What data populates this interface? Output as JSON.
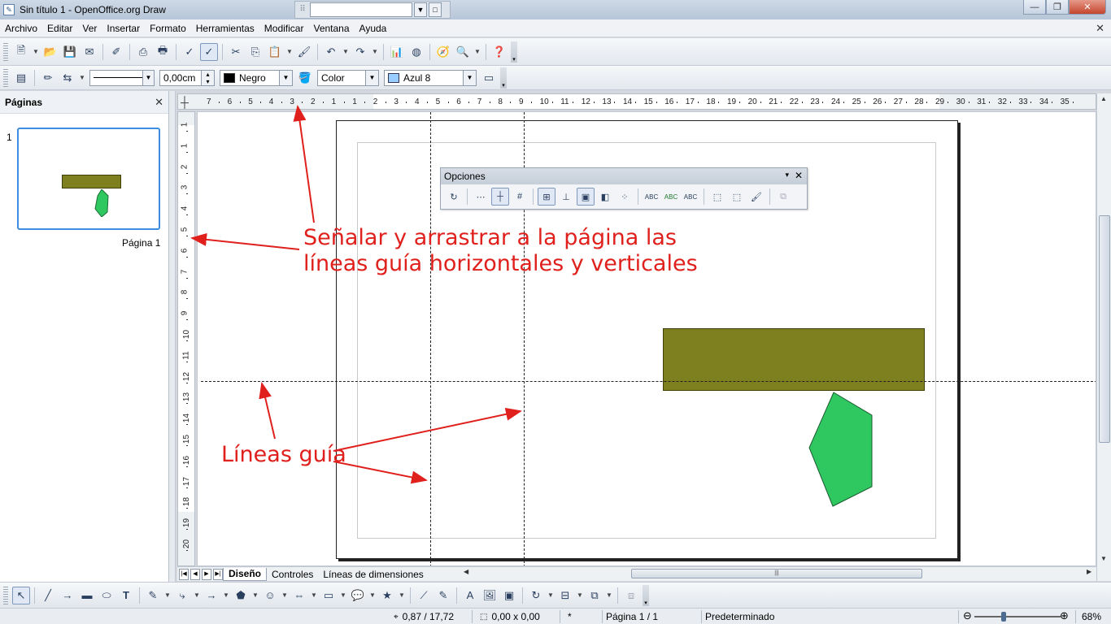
{
  "window": {
    "title": "Sin título 1 - OpenOffice.org Draw",
    "controls": {
      "minimize": "—",
      "maximize": "❐",
      "close": "✕"
    }
  },
  "menu": {
    "items": [
      "Archivo",
      "Editar",
      "Ver",
      "Insertar",
      "Formato",
      "Herramientas",
      "Modificar",
      "Ventana",
      "Ayuda"
    ],
    "doc_close": "✕"
  },
  "line_toolbar": {
    "line_width": "0,00cm",
    "line_color": "Negro",
    "line_color_hex": "#000000",
    "area_style": "Color",
    "area_color": "Azul 8",
    "area_color_hex": "#99ccff"
  },
  "pages_panel": {
    "title": "Páginas",
    "close": "✕",
    "page_number": "1",
    "page_label": "Página 1"
  },
  "rulers": {
    "horizontal": [
      "7",
      "6",
      "5",
      "4",
      "3",
      "2",
      "1",
      "1",
      "2",
      "3",
      "4",
      "5",
      "6",
      "7",
      "8",
      "9",
      "10",
      "11",
      "12",
      "13",
      "14",
      "15",
      "16",
      "17",
      "18",
      "19",
      "20",
      "21",
      "22",
      "23",
      "24",
      "25",
      "26",
      "27",
      "28",
      "29",
      "30",
      "31",
      "32",
      "33",
      "34",
      "35"
    ],
    "vertical": [
      "1",
      "1",
      "2",
      "3",
      "4",
      "5",
      "6",
      "7",
      "8",
      "9",
      "10",
      "11",
      "12",
      "13",
      "14",
      "15",
      "16",
      "17",
      "18",
      "19",
      "20"
    ]
  },
  "options_toolbar": {
    "title": "Opciones",
    "menu": "▾",
    "close": "✕"
  },
  "annotations": {
    "instruction_line1": "Señalar y arrastrar a la página las",
    "instruction_line2": "líneas guía horizontales y verticales",
    "guides_label": "Líneas guía"
  },
  "tabs": [
    "Diseño",
    "Controles",
    "Líneas de dimensiones"
  ],
  "status": {
    "position": "0,87 / 17,72",
    "size": "0,00 x 0,00",
    "modified": "*",
    "page": "Página 1 / 1",
    "style": "Predeterminado",
    "zoom": "68%"
  },
  "colors": {
    "olive_shape": "#7e7f1e",
    "green_shape": "#2ec760",
    "annotation": "#e0201c",
    "selection": "#3d8ee0"
  }
}
